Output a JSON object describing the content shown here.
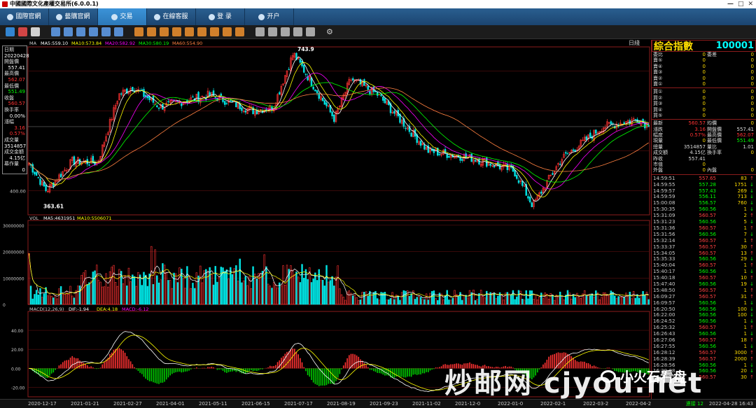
{
  "window": {
    "title": "中國國際文化產權交易所(6.0.0.1)"
  },
  "nav": [
    {
      "label": "國際官網",
      "icon": "globe-icon"
    },
    {
      "label": "藝購官網",
      "icon": "globe-icon"
    },
    {
      "label": "交易",
      "icon": "chart-icon",
      "active": true
    },
    {
      "label": "在線客服",
      "icon": "chat-icon"
    },
    {
      "label": "登 录",
      "icon": "user-icon"
    },
    {
      "label": "开户",
      "icon": "card-icon"
    }
  ],
  "colors": {
    "up": "#ff3232",
    "down": "#00e0e0",
    "ma5": "#ffffff",
    "ma10": "#ffff00",
    "ma20": "#ff00ff",
    "ma30": "#00ff00",
    "ma60": "#ff8040",
    "panel_border": "#8b1c1c"
  },
  "chart": {
    "period_label": "日綫",
    "ma_legend": [
      "MA",
      "MA5:559.10",
      "MA10:573.84",
      "MA20:582.92",
      "MA30:580.19",
      "MA60:554.90"
    ],
    "high_label": "743.9",
    "low_label": "363.61",
    "price_axis_label": "400.00",
    "vol_legend": [
      "VOL",
      "MA5:4631951",
      "MA10:5506071"
    ],
    "vol_axis": [
      "30000000",
      "20000000",
      "10000000",
      "0"
    ],
    "macd_legend": [
      "MACD(12,26,9)",
      "DIF:-1.94",
      "DEA:4.18",
      "MACD:-6.12"
    ],
    "macd_axis": [
      "40.00",
      "20.00",
      "0.00",
      "-20.00"
    ]
  },
  "infobox": [
    {
      "label": "日期",
      "value": "20220428"
    },
    {
      "label": "開盤價",
      "value": "557.41"
    },
    {
      "label": "最高價",
      "value": "562.07"
    },
    {
      "label": "最低價",
      "value": "551.49"
    },
    {
      "label": "收盤",
      "value": "560.57"
    },
    {
      "label": "換手率",
      "value": "0.00%"
    },
    {
      "label": "漲幅",
      "value": "3.16"
    },
    {
      "label": "",
      "value": "0.57%"
    },
    {
      "label": "成交量",
      "value": "3514857"
    },
    {
      "label": "成交金額",
      "value": "4.15亿"
    },
    {
      "label": "幕作量",
      "value": "0"
    }
  ],
  "right_panel": {
    "name": "綜合指數",
    "code": "100001",
    "book_top": [
      {
        "a": "委比",
        "b": "0",
        "c": "委差",
        "d": "0"
      },
      {
        "a": "賣⑤",
        "b": "0",
        "c": "",
        "d": "0"
      },
      {
        "a": "賣④",
        "b": "0",
        "c": "",
        "d": "0"
      },
      {
        "a": "賣③",
        "b": "0",
        "c": "",
        "d": "0"
      },
      {
        "a": "賣②",
        "b": "0",
        "c": "",
        "d": "0"
      },
      {
        "a": "賣①",
        "b": "0",
        "c": "",
        "d": "0"
      }
    ],
    "book_bottom": [
      {
        "a": "買①",
        "b": "0",
        "c": "",
        "d": "0"
      },
      {
        "a": "買②",
        "b": "0",
        "c": "",
        "d": "0"
      },
      {
        "a": "買③",
        "b": "0",
        "c": "",
        "d": "0"
      },
      {
        "a": "買④",
        "b": "0",
        "c": "",
        "d": "0"
      },
      {
        "a": "買⑤",
        "b": "0",
        "c": "",
        "d": "0"
      }
    ],
    "stats": [
      {
        "a": "最新",
        "b": "560.57",
        "c": "均價",
        "d": "0"
      },
      {
        "a": "漲跌",
        "b": "3.16",
        "c": "開盤價",
        "d": "557.41"
      },
      {
        "a": "幅度",
        "b": "0.57%",
        "c": "最高價",
        "d": "562.07"
      },
      {
        "a": "現量",
        "b": "0",
        "c": "最低價",
        "d": "551.49"
      },
      {
        "a": "總量",
        "b": "3514857",
        "c": "量比",
        "d": "1.01"
      },
      {
        "a": "成交額",
        "b": "4.15亿",
        "c": "換手率",
        "d": "0"
      },
      {
        "a": "昨收",
        "b": "557.41",
        "c": "",
        "d": ""
      },
      {
        "a": "市值",
        "b": "0",
        "c": "",
        "d": ""
      },
      {
        "a": "外盤",
        "b": "0",
        "c": "內盤",
        "d": "0"
      }
    ],
    "ticks": [
      {
        "time": "14:59:51",
        "price": "557.65",
        "vol": "83",
        "dir": "↑"
      },
      {
        "time": "14:59:55",
        "price": "557.28",
        "vol": "1751",
        "dir": "↓"
      },
      {
        "time": "14:59:57",
        "price": "557.43",
        "vol": "269",
        "dir": "↓"
      },
      {
        "time": "14:59:59",
        "price": "556.11",
        "vol": "713",
        "dir": "↓"
      },
      {
        "time": "15:00:08",
        "price": "556.57",
        "vol": "760",
        "dir": "↓"
      },
      {
        "time": "15:30:35",
        "price": "560.56",
        "vol": "1",
        "dir": "↓"
      },
      {
        "time": "15:31:09",
        "price": "560.57",
        "vol": "2",
        "dir": "↑"
      },
      {
        "time": "15:31:23",
        "price": "560.56",
        "vol": "5",
        "dir": "↓"
      },
      {
        "time": "15:31:36",
        "price": "560.57",
        "vol": "1",
        "dir": "↑"
      },
      {
        "time": "15:31:56",
        "price": "560.56",
        "vol": "7",
        "dir": "↓"
      },
      {
        "time": "15:32:14",
        "price": "560.57",
        "vol": "1",
        "dir": "↑"
      },
      {
        "time": "15:33:37",
        "price": "560.57",
        "vol": "30",
        "dir": "↑"
      },
      {
        "time": "15:34:05",
        "price": "560.57",
        "vol": "13",
        "dir": "↑"
      },
      {
        "time": "15:35:33",
        "price": "560.56",
        "vol": "29",
        "dir": "↓"
      },
      {
        "time": "15:40:04",
        "price": "560.57",
        "vol": "1",
        "dir": "↑"
      },
      {
        "time": "15:40:17",
        "price": "560.56",
        "vol": "1",
        "dir": "↓"
      },
      {
        "time": "15:40:18",
        "price": "560.57",
        "vol": "10",
        "dir": "↑"
      },
      {
        "time": "15:47:40",
        "price": "560.56",
        "vol": "19",
        "dir": "↓"
      },
      {
        "time": "15:48:50",
        "price": "560.57",
        "vol": "1",
        "dir": "↑"
      },
      {
        "time": "16:09:27",
        "price": "560.57",
        "vol": "31",
        "dir": "↑"
      },
      {
        "time": "16:09:57",
        "price": "560.56",
        "vol": "1",
        "dir": "↓"
      },
      {
        "time": "16:20:50",
        "price": "560.56",
        "vol": "100",
        "dir": "↓"
      },
      {
        "time": "16:22:00",
        "price": "560.56",
        "vol": "100",
        "dir": "↓"
      },
      {
        "time": "16:24:52",
        "price": "560.56",
        "vol": "1",
        "dir": "↓"
      },
      {
        "time": "16:25:32",
        "price": "560.57",
        "vol": "1",
        "dir": "↑"
      },
      {
        "time": "16:26:43",
        "price": "560.56",
        "vol": "1",
        "dir": "↓"
      },
      {
        "time": "16:27:06",
        "price": "560.57",
        "vol": "18",
        "dir": "↑"
      },
      {
        "time": "16:27:55",
        "price": "560.56",
        "vol": "1",
        "dir": "↓"
      },
      {
        "time": "16:28:12",
        "price": "560.57",
        "vol": "3000",
        "dir": "↑"
      },
      {
        "time": "16:28:39",
        "price": "560.57",
        "vol": "2000",
        "dir": "↑"
      },
      {
        "time": "16:28:56",
        "price": "560.56",
        "vol": "1",
        "dir": "↓"
      },
      {
        "time": "16:29:08",
        "price": "560.56",
        "vol": "20",
        "dir": "↓"
      },
      {
        "time": "16:30:25",
        "price": "560.57",
        "vol": "30",
        "dir": "↑"
      }
    ]
  },
  "x_axis_labels": [
    "2020-12-17",
    "2021-01-21",
    "2021-02-27",
    "2021-04-01",
    "2021-05-11",
    "2021-06-15",
    "2021-07-17",
    "2021-08-19",
    "2021-09-23",
    "2021-11-02",
    "2021-12-0",
    "2022-01-0",
    "2022-02-1",
    "2022-03-2",
    "2022-04-2"
  ],
  "status": {
    "connection": "連接 12",
    "datetime": "2022-04-28 16:43"
  },
  "watermark": {
    "text": "炒邮网 cjyou.net",
    "badge": "小火石看盘"
  },
  "chart_data": {
    "type": "candlestick",
    "x_range": [
      "2020-12-17",
      "2022-04-28"
    ],
    "price_range": [
      363.61,
      743.9
    ],
    "y_tick_labels": [
      "400.00"
    ],
    "annotations": [
      {
        "text": "743.9",
        "kind": "high"
      },
      {
        "text": "363.61",
        "kind": "low"
      }
    ],
    "price_anchors": [
      {
        "date": "2020-12-17",
        "close": 470
      },
      {
        "date": "2020-12-31",
        "close": 400
      },
      {
        "date": "2021-01-21",
        "close": 475
      },
      {
        "date": "2021-02-10",
        "close": 470
      },
      {
        "date": "2021-02-27",
        "close": 640
      },
      {
        "date": "2021-03-10",
        "close": 660
      },
      {
        "date": "2021-04-01",
        "close": 610
      },
      {
        "date": "2021-05-11",
        "close": 640
      },
      {
        "date": "2021-06-15",
        "close": 600
      },
      {
        "date": "2021-07-01",
        "close": 610
      },
      {
        "date": "2021-07-17",
        "close": 743.9
      },
      {
        "date": "2021-08-19",
        "close": 580
      },
      {
        "date": "2021-09-01",
        "close": 680
      },
      {
        "date": "2021-09-23",
        "close": 640
      },
      {
        "date": "2021-11-02",
        "close": 500
      },
      {
        "date": "2021-12-10",
        "close": 480
      },
      {
        "date": "2022-01-10",
        "close": 450
      },
      {
        "date": "2022-01-25",
        "close": 363.61
      },
      {
        "date": "2022-02-17",
        "close": 480
      },
      {
        "date": "2022-03-22",
        "close": 560
      },
      {
        "date": "2022-04-20",
        "close": 580
      },
      {
        "date": "2022-04-28",
        "close": 560.57
      }
    ],
    "volume": {
      "range": [
        0,
        30000000
      ],
      "y_tick_labels": [
        "30000000",
        "20000000",
        "10000000",
        "0"
      ],
      "ma5": 4631951,
      "ma10": 5506071
    },
    "macd": {
      "range": [
        -20,
        40
      ],
      "y_tick_labels": [
        "40.00",
        "20.00",
        "0.00",
        "-20.00"
      ],
      "dif": -1.94,
      "dea": 4.18,
      "macd": -6.12
    },
    "series": [
      {
        "name": "MA5",
        "value": 559.1
      },
      {
        "name": "MA10",
        "value": 573.84
      },
      {
        "name": "MA20",
        "value": 582.92
      },
      {
        "name": "MA30",
        "value": 580.19
      },
      {
        "name": "MA60",
        "value": 554.9
      }
    ]
  }
}
